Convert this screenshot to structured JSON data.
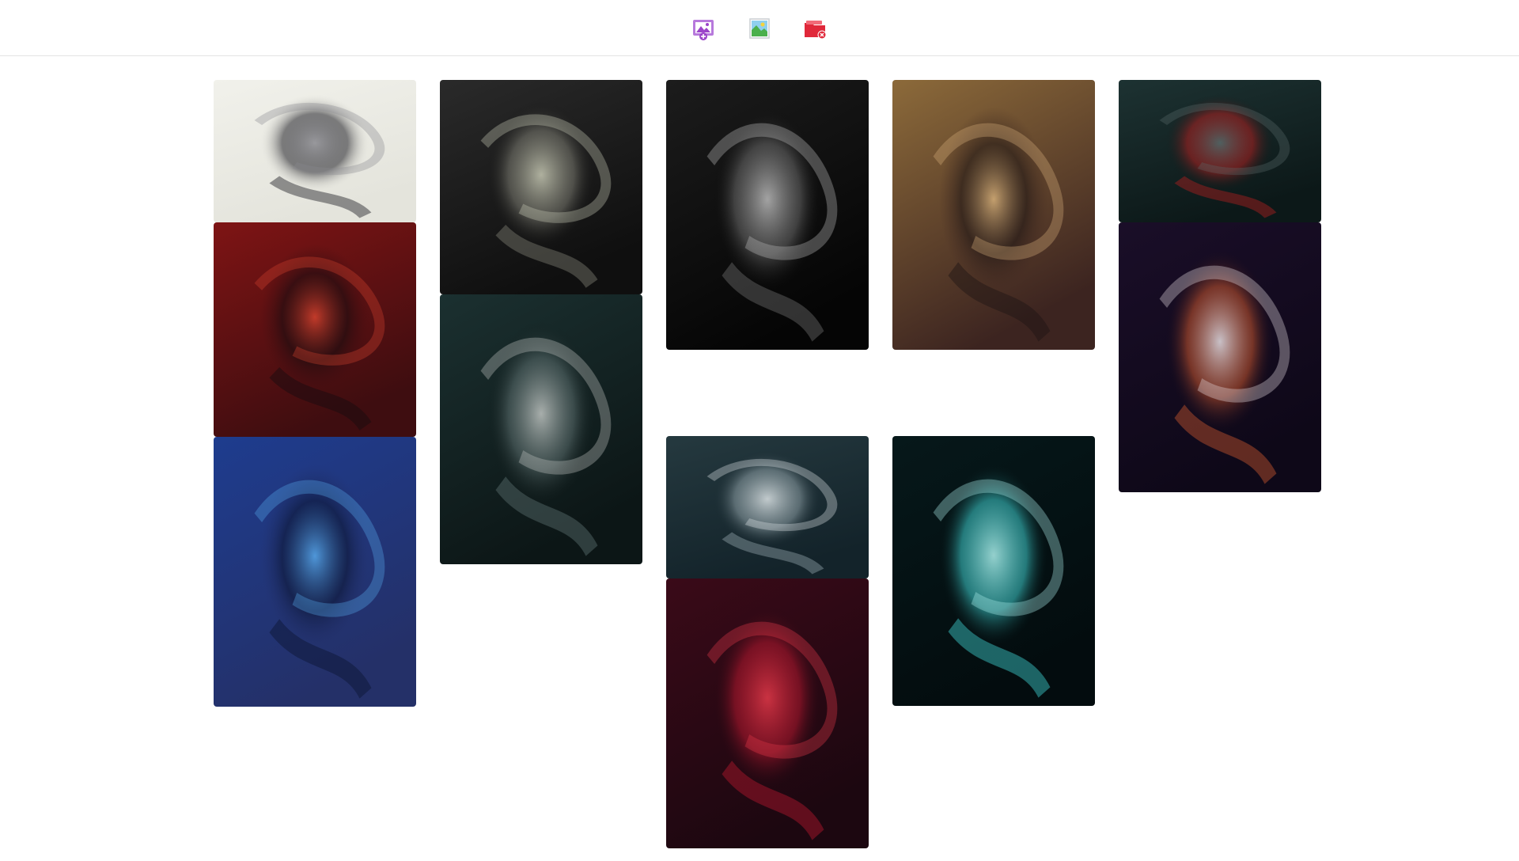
{
  "toolbar": {
    "buttons": [
      {
        "name": "add-image-button",
        "icon": "image-add-icon",
        "color": "#9b44c9"
      },
      {
        "name": "photo-button",
        "icon": "photo-icon",
        "color": "#4fa3d9"
      },
      {
        "name": "remove-folder-button",
        "icon": "folder-remove-icon",
        "color": "#e0283a"
      }
    ]
  },
  "gallery": {
    "columns": [
      {
        "tiles": [
          {
            "name": "artwork-white-swirl-portrait",
            "palette": [
              "#f1f1eb",
              "#e4e4dc",
              "#1d1d24",
              "#8a8a90"
            ]
          },
          {
            "name": "artwork-red-figure",
            "palette": [
              "#7e1414",
              "#3e0d10",
              "#140c10",
              "#d4422e"
            ]
          },
          {
            "name": "artwork-blue-face",
            "palette": [
              "#1e3c8e",
              "#243068",
              "#0b1430",
              "#57a8ea"
            ]
          }
        ]
      },
      {
        "tiles": [
          {
            "name": "artwork-dark-grunge-face",
            "palette": [
              "#2a2a2a",
              "#0f0f0f",
              "#7c7c72",
              "#c9cbb6"
            ]
          },
          {
            "name": "artwork-teal-mask-face",
            "palette": [
              "#1b3030",
              "#0c1616",
              "#5c6e6e",
              "#c2c7c4"
            ]
          }
        ]
      },
      {
        "tiles": [
          {
            "name": "artwork-black-white-portrait",
            "palette": [
              "#1c1c1c",
              "#050505",
              "#6a6a6a",
              "#bdbdbd"
            ]
          },
          {
            "name": "artwork-white-skull-face",
            "palette": [
              "#25393f",
              "#13232a",
              "#8fa0a6",
              "#dfe6e8"
            ]
          },
          {
            "name": "artwork-red-swirl-face",
            "palette": [
              "#3a0a18",
              "#1c0710",
              "#b5182f",
              "#e63a4a"
            ]
          }
        ]
      },
      {
        "tiles": [
          {
            "name": "artwork-golden-figure",
            "palette": [
              "#8c6a3a",
              "#3c2420",
              "#1c1414",
              "#d6b07a"
            ]
          },
          {
            "name": "artwork-cyan-paint-face",
            "palette": [
              "#06181a",
              "#030c0e",
              "#3ed0d0",
              "#aef2ee"
            ]
          }
        ]
      },
      {
        "tiles": [
          {
            "name": "artwork-dark-teal-red-face",
            "palette": [
              "#1d3232",
              "#0c1818",
              "#b02020",
              "#5a6a6a"
            ]
          },
          {
            "name": "artwork-orange-swirl-face",
            "palette": [
              "#1a0e28",
              "#0e0818",
              "#c8562e",
              "#e8e0e4"
            ]
          }
        ]
      }
    ]
  }
}
